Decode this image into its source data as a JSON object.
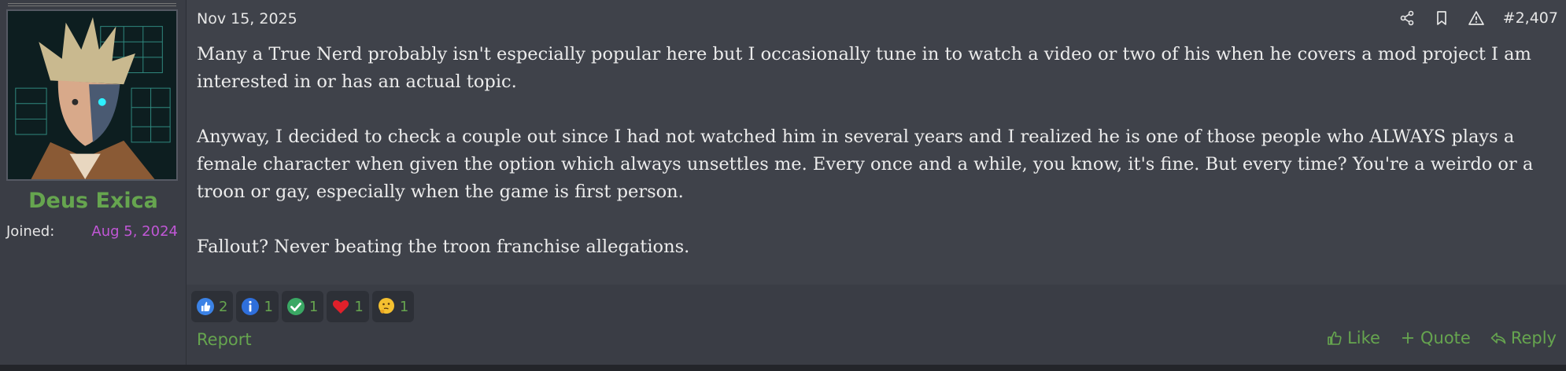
{
  "user": {
    "name": "Deus Exica",
    "joined_label": "Joined:",
    "joined_date": "Aug 5, 2024"
  },
  "post": {
    "date": "Nov 15, 2025",
    "number": "#2,407",
    "paragraphs": [
      "Many a True Nerd probably isn't especially popular here but I occasionally tune in to watch a video or two of his when he covers a mod project I am interested in or has an actual topic.",
      "Anyway, I decided to check a couple out since I had not watched him in several years and I realized he is one of those people who ALWAYS plays a female character when given the option which always unsettles me. Every once and a while, you know, it's fine. But every time? You're a weirdo or a troon or gay, especially when the game is first person.",
      "Fallout? Never beating the troon franchise allegations."
    ]
  },
  "tools": [
    "share-icon",
    "bookmark-icon",
    "report-warning-icon"
  ],
  "reactions": [
    {
      "icon": "thumbs-up-icon",
      "count": "2"
    },
    {
      "icon": "informative-icon",
      "count": "1"
    },
    {
      "icon": "agree-check-icon",
      "count": "1"
    },
    {
      "icon": "heart-icon",
      "count": "1"
    },
    {
      "icon": "thinking-face-icon",
      "count": "1"
    }
  ],
  "footer": {
    "report_label": "Report",
    "like_label": "Like",
    "quote_label": "Quote",
    "reply_label": "Reply"
  },
  "colors": {
    "accent_green": "#66a54f",
    "joined_purple": "#c157d6",
    "background": "#2d3037",
    "content_bg": "#3f424a"
  }
}
